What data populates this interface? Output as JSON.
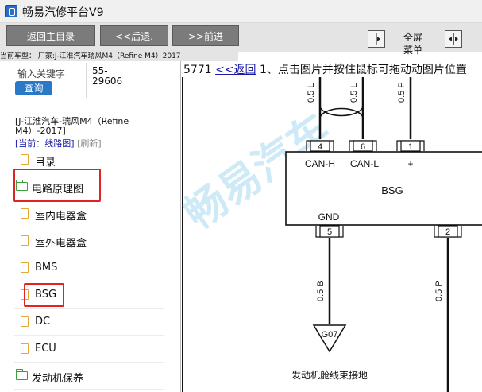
{
  "window": {
    "title": "畅易汽修平台V9"
  },
  "toolbar": {
    "back_main": "返回主目录",
    "back": "<<后退.",
    "forward": ">>前进",
    "fullscreen_label": "全屏",
    "menu_label": "菜单"
  },
  "car_line": "当前车型： 厂家:J-江淮汽车瑞风M4（Refine M4）2017",
  "search": {
    "label": "输入关键字",
    "button": "查询",
    "code": "55-29606"
  },
  "model": {
    "name": "[J-江淮汽车-瑞风M4（Refine M4）-2017]",
    "crumb_current": "[当前：线路图]",
    "crumb_refresh": "[刷新]"
  },
  "tree": [
    {
      "label": "目录",
      "type": "file"
    },
    {
      "label": "电路原理图",
      "type": "folder"
    },
    {
      "label": "室内电器盒",
      "type": "file"
    },
    {
      "label": "室外电器盒",
      "type": "file"
    },
    {
      "label": "BMS",
      "type": "file"
    },
    {
      "label": "BSG",
      "type": "file"
    },
    {
      "label": "DC",
      "type": "file"
    },
    {
      "label": "ECU",
      "type": "file"
    },
    {
      "label": "发动机保养",
      "type": "folder"
    }
  ],
  "main": {
    "code": "5771",
    "back_link": "<<返回",
    "instruction": "1、点击图片并按住鼠标可拖动动图片位置",
    "watermark": "畅易汽车"
  },
  "diagram": {
    "module": "BSG",
    "pins": [
      {
        "num": "4",
        "label": "CAN-H"
      },
      {
        "num": "6",
        "label": "CAN-L"
      },
      {
        "num": "1",
        "label": "+"
      },
      {
        "num": "5",
        "label": "GND"
      },
      {
        "num": "2",
        "label": ""
      }
    ],
    "wires": [
      "0.5 B",
      "0.5 P",
      "0.5 L",
      "0.5 L",
      "0.5 P"
    ],
    "ground": "G07",
    "ground_label": "发动机舱线束接地"
  },
  "colors": {
    "highlight": "#e02323",
    "toolbar_button": "#7b7b7b",
    "link": "#1a1aa8",
    "search_button": "#2a78c8"
  }
}
